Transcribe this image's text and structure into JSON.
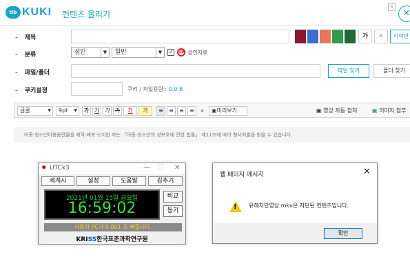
{
  "header": {
    "logo_badge": "tlb",
    "logo_text": "KUKI",
    "title": "컨텐츠 올리기",
    "close_glyph": "✕"
  },
  "form": {
    "title_label": "제목",
    "title_value": "",
    "title_colors": [
      "#8b1a2e",
      "#3a6fcf",
      "#e8785a",
      "#2e9d4d",
      "#1f6b3a"
    ],
    "bold_btn": "가",
    "clear_btn": "✕",
    "emoticon_btn": "이이만",
    "category_label": "분류",
    "category1": "성인",
    "category2": "일반",
    "adult_check": "✓",
    "adult_icon": "19",
    "adult_label": "성인자료",
    "file_label": "파일/폴더",
    "file_value": "",
    "file_find_btn": "파일 찾기",
    "folder_find_btn": "폴더 찾기",
    "cookie_label": "쿠키설정",
    "cookie_value": "",
    "cookie_size_prefix": "쿠키 / 파일용량 :",
    "cookie_size_value": "0.0 B",
    "dash": "-"
  },
  "editor_toolbar": {
    "font": "글꼴",
    "size": "9pt",
    "bold": "가",
    "underline": "가",
    "italic": "가",
    "strike": "가",
    "text_color": "가",
    "highlight": "가",
    "align_left": "≡",
    "align_center": "≡",
    "align_right": "≡",
    "justify": "≡",
    "more": "»",
    "preview": "미리보기",
    "auto_video": "영상 자동 첨쳐",
    "image_attach": "이미지 첨부"
  },
  "notice": {
    "text": "아동·청소년이용음란물을 제작·배포·소지한 자는 「아동·청소년의 성보호에 관한 법률」 제11조에 따라 형사처벌을 받을 수 있습니다.",
    "close_glyph": "✕"
  },
  "utck3": {
    "title": "UTCk3",
    "minimize": "—",
    "maximize": "☐",
    "close": "✕",
    "menu": [
      "세계시",
      "설정",
      "도움말",
      "감추기"
    ],
    "date": "2021년 01월 15일 금요일",
    "time": "16:59:02",
    "compare_btn": "비교",
    "sync_btn": "동기",
    "status": "사용자 PC가 0.001 초 빠릅니다.",
    "brand_prefix": "KRI",
    "brand_ss": "SS",
    "brand_suffix": "한국표준과학연구원"
  },
  "dialog": {
    "title": "웹 페이지 메시지",
    "close": "✕",
    "warning_mark": "!",
    "message": "유해차단영상.mkv은  차단된 컨텐츠입니다.",
    "ok": "확인"
  }
}
